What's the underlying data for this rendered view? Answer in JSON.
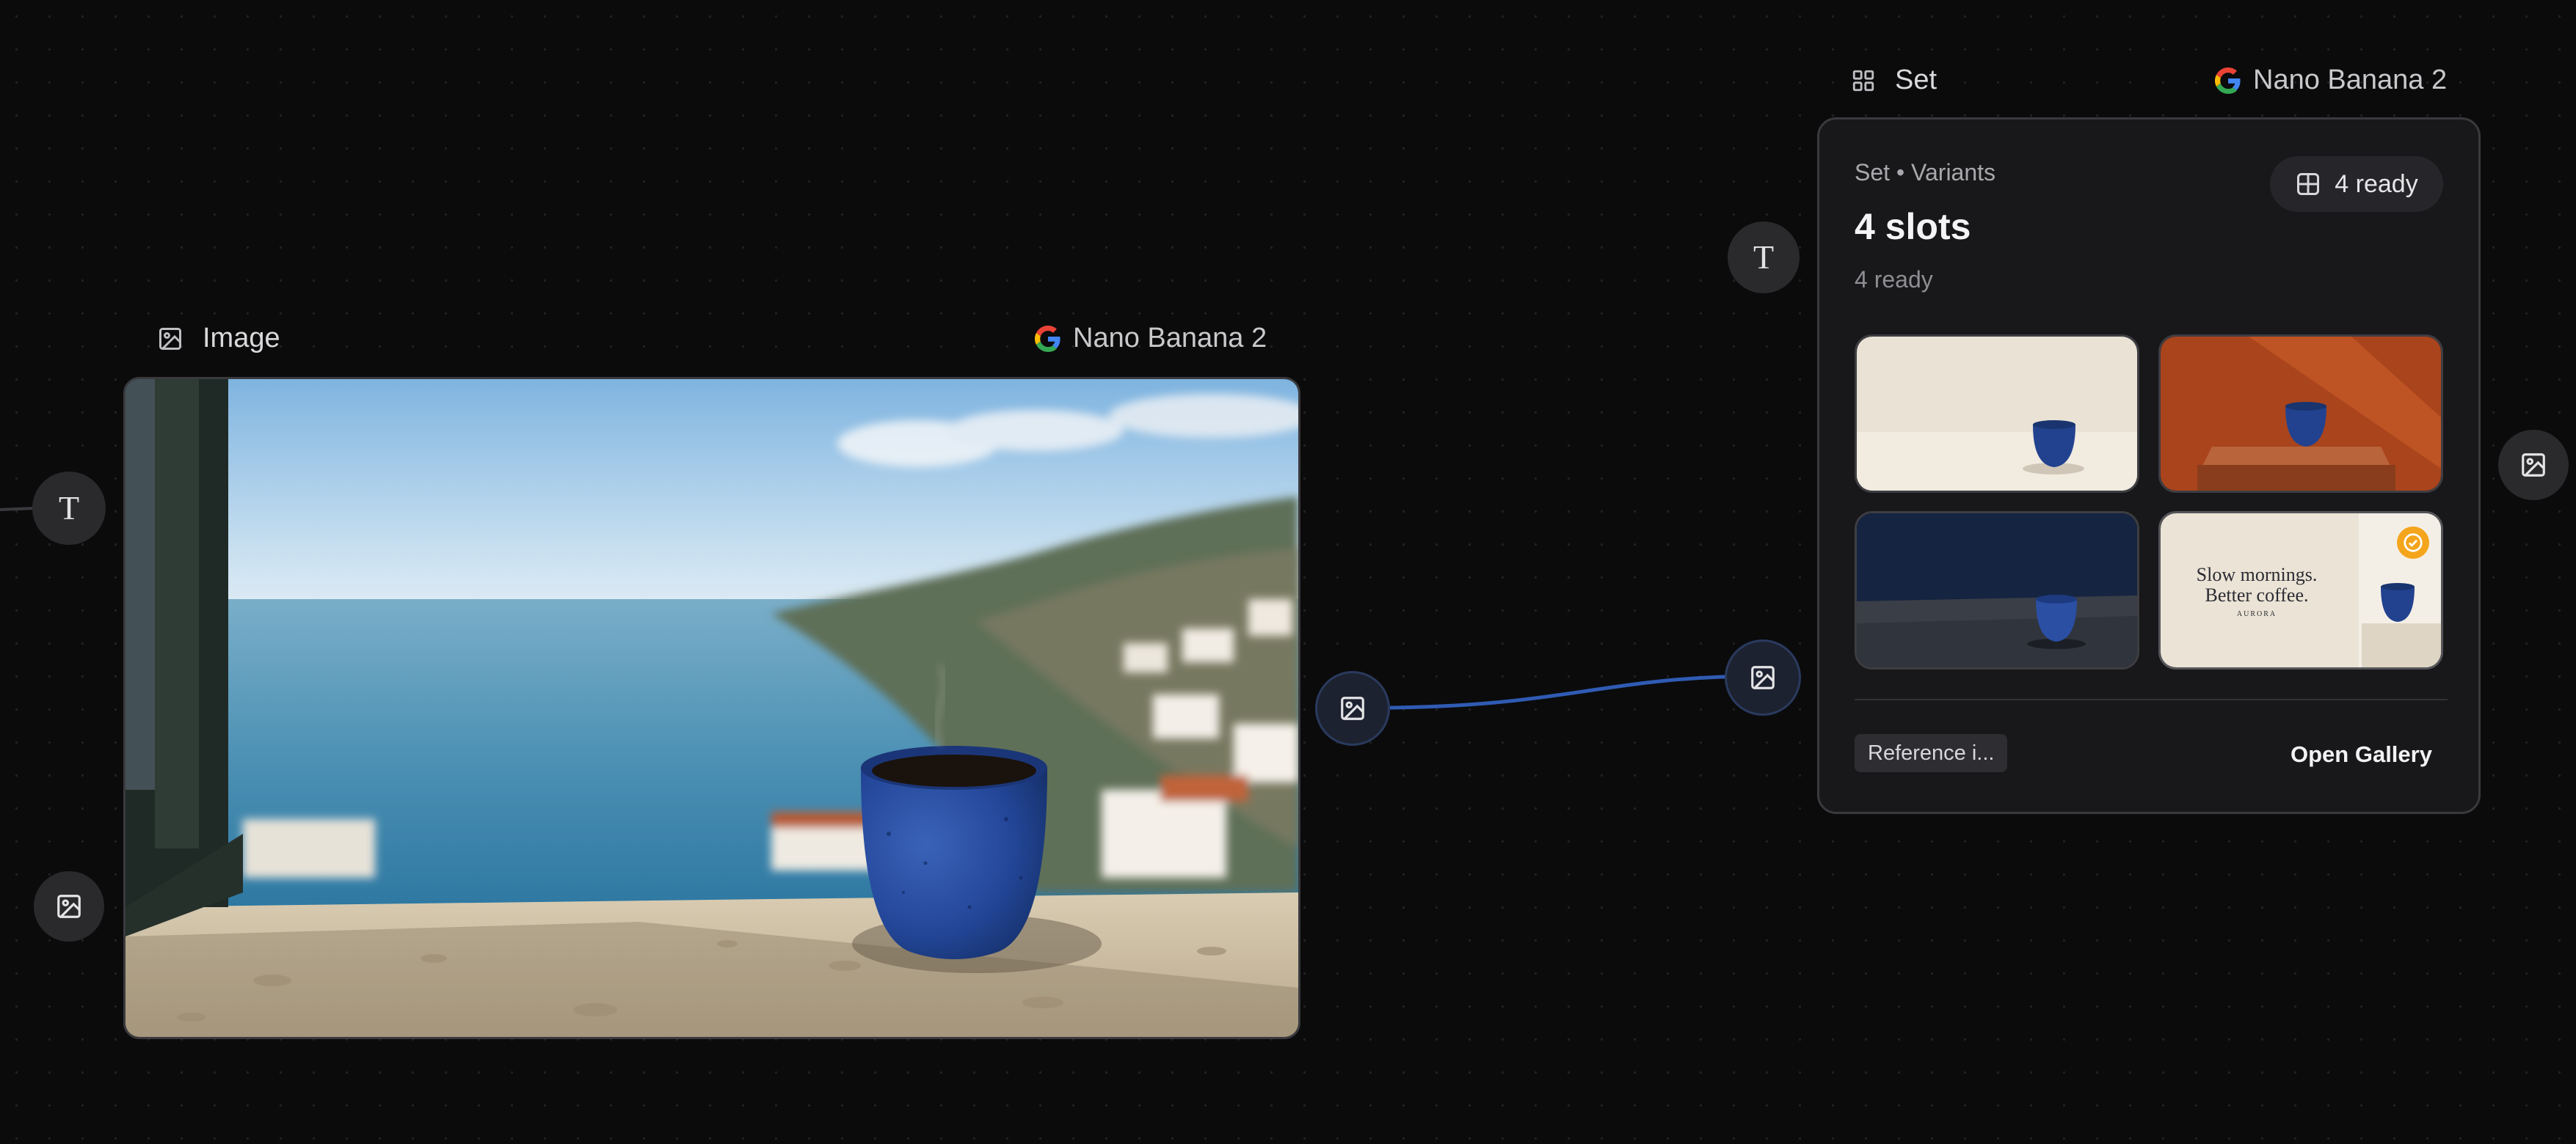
{
  "image_node": {
    "title": "Image",
    "model": "Nano Banana 2",
    "icon": "image-icon",
    "model_icon": "google-g-icon"
  },
  "set_node": {
    "title": "Set",
    "model": "Nano Banana 2",
    "icon": "grid-icon",
    "model_icon": "google-g-icon",
    "subtitle": "Set • Variants",
    "heading": "4 slots",
    "status": "4 ready",
    "badge": "4 ready",
    "footer": {
      "reference_chip": "Reference i...",
      "open_gallery": "Open Gallery"
    },
    "thumbnails": [
      {
        "name": "cream-scene",
        "selected": false
      },
      {
        "name": "terracotta-scene",
        "selected": false
      },
      {
        "name": "navy-scene",
        "selected": false
      },
      {
        "name": "ad-scene",
        "selected": true,
        "text_line1": "Slow mornings.",
        "text_line2": "Better coffee.",
        "brand": "AURORA"
      }
    ]
  },
  "ports": [
    {
      "name": "text-input-port-left",
      "icon": "text-icon"
    },
    {
      "name": "image-input-port-left",
      "icon": "image-icon"
    },
    {
      "name": "image-output-port",
      "icon": "image-icon"
    },
    {
      "name": "set-text-input-port",
      "icon": "text-icon"
    },
    {
      "name": "set-image-input-port",
      "icon": "image-icon"
    },
    {
      "name": "set-image-output-port",
      "icon": "image-icon"
    }
  ],
  "colors": {
    "canvas_bg": "#0b0b0c",
    "card_bg": "#18181a",
    "connector": "#2f5bb3",
    "selected_check": "#f4a51c"
  }
}
